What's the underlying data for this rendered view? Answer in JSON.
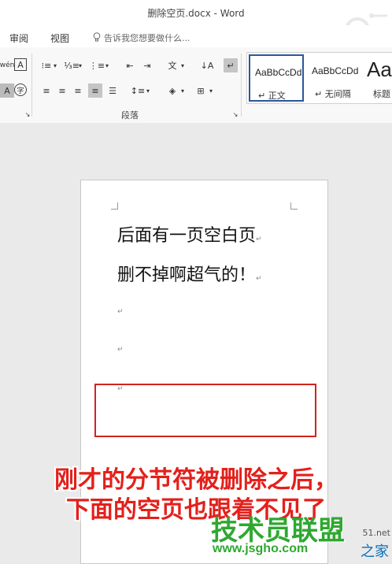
{
  "window": {
    "title": "删除空页.docx - Word"
  },
  "tabs": [
    {
      "label": "审阅"
    },
    {
      "label": "视图"
    }
  ],
  "tell_me": {
    "placeholder": "告诉我您想要做什么..."
  },
  "ribbon": {
    "group_label": "段落",
    "styles": [
      {
        "preview": "AaBbCcDd",
        "name": "↵ 正文",
        "selected": true
      },
      {
        "preview": "AaBbCcDd",
        "name": "↵ 无间隔",
        "selected": false
      },
      {
        "preview": "AaB",
        "name": "标题",
        "selected": false
      }
    ]
  },
  "document": {
    "lines": [
      "后面有一页空白页",
      "删不掉啊超气的！"
    ],
    "paragraph_mark": "↵"
  },
  "caption": {
    "line1": "刚才的分节符被删除之后，",
    "line2": "下面的空页也跟着不见了"
  },
  "watermark": {
    "logo": "技术员联盟",
    "url": "www.jsgho.com",
    "tail": "之家",
    "tail_small": "51.net"
  },
  "colors": {
    "accent": "#2b579a",
    "highlight": "#d2231e",
    "watermark_green": "#2ea830"
  }
}
